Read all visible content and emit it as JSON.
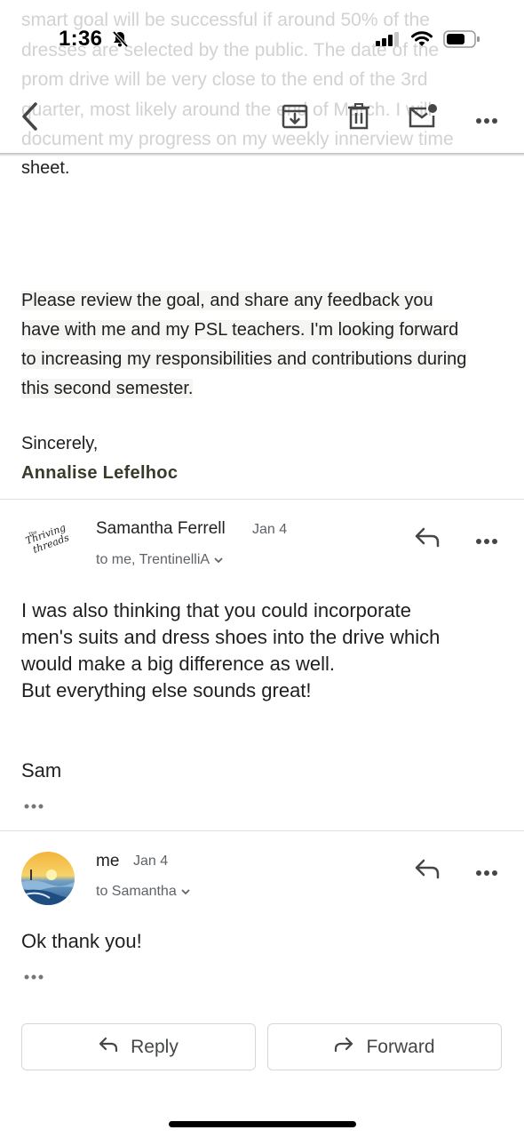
{
  "status": {
    "time": "1:36"
  },
  "faded_lines": [
    "smart goal will be successful if around 50% of the",
    "dresses are selected by the public. The date of the",
    "prom drive will be very close to the end of the 3rd",
    "quarter, most likely around the end of March. I will",
    "document my progress on my weekly innerview time"
  ],
  "email1": {
    "line_sheet": "sheet.",
    "paragraph_lines": [
      "Please review the goal, and share any feedback you",
      "have with me and my PSL teachers.  I'm looking forward",
      "to increasing my responsibilities and contributions during",
      "this second semester."
    ],
    "closing": "Sincerely,",
    "signature": "Annalise Lefelhoc"
  },
  "message2": {
    "sender": "Samantha Ferrell",
    "date": "Jan 4",
    "recipients": "to me, TrentinelliA",
    "avatar_text": "The Thriving Threads",
    "body_lines": [
      "I was also thinking that you could incorporate",
      "men's suits and dress shoes into the drive which",
      "would make a big difference as well.",
      "But everything else sounds great!"
    ],
    "signoff": "Sam"
  },
  "message3": {
    "sender": "me",
    "date": "Jan 4",
    "recipients": "to Samantha",
    "body": "Ok thank you!"
  },
  "actions": {
    "reply": "Reply",
    "forward": "Forward"
  },
  "colors": {
    "icon": "#444746",
    "divider": "#e0e0e0",
    "secondary_text": "#5f6368"
  }
}
